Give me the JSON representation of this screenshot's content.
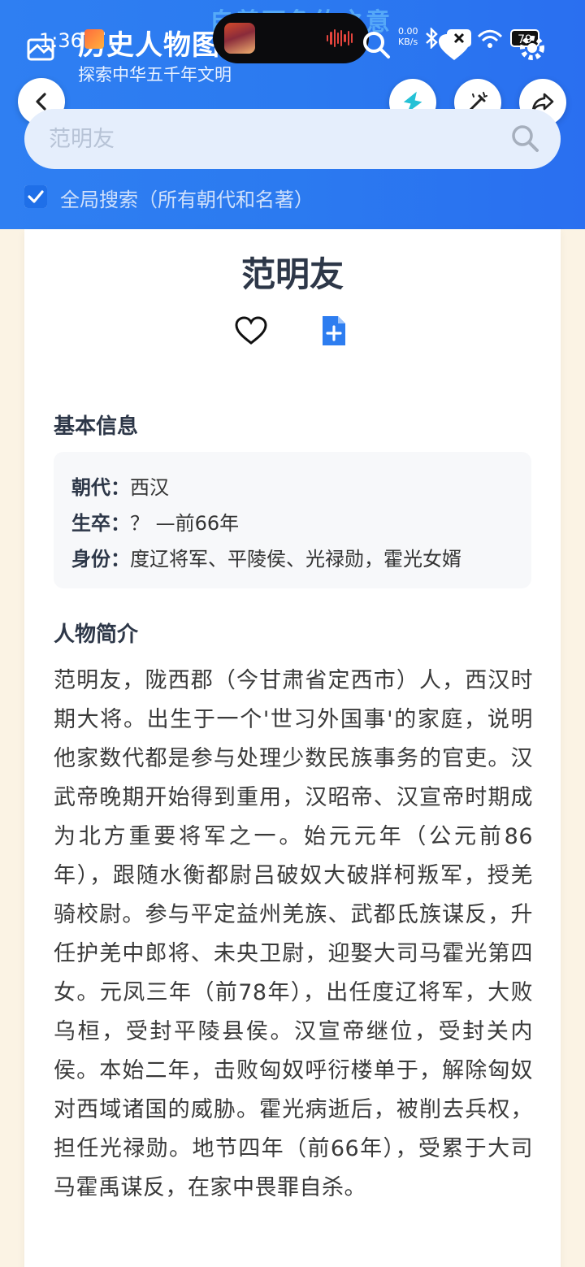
{
  "header": {
    "ghost_text": "自善不负约之意",
    "time": "1:36",
    "app_title": "历史人物图谱",
    "app_subtitle": "探索中华五千年文明",
    "net_speed_value": "0.00",
    "net_speed_unit": "KB/s",
    "battery": "79",
    "accent_color": "#2b7af0"
  },
  "actions": {
    "back": "back-icon",
    "bolt": "bolt-icon",
    "wand": "wand-icon",
    "share": "share-icon"
  },
  "search": {
    "value": "范明友",
    "placeholder": "范明友",
    "global_checked": true,
    "global_label": "全局搜索（所有朝代和名著）"
  },
  "person": {
    "name": "范明友",
    "basic_title": "基本信息",
    "basic": [
      {
        "key": "朝代：",
        "value": "西汉"
      },
      {
        "key": "生卒：",
        "value": "？ —前66年"
      },
      {
        "key": "身份：",
        "value": "度辽将军、平陵侯、光禄勋，霍光女婿"
      }
    ],
    "intro_title": "人物简介",
    "bio": "范明友，陇西郡（今甘肃省定西市）人，西汉时期大将。出生于一个'世习外国事'的家庭，说明他家数代都是参与处理少数民族事务的官吏。汉武帝晚期开始得到重用，汉昭帝、汉宣帝时期成为北方重要将军之一。始元元年（公元前86年），跟随水衡都尉吕破奴大破牂柯叛军，授羌骑校尉。参与平定益州羌族、武都氐族谋反，升任护羌中郎将、未央卫尉，迎娶大司马霍光第四女。元凤三年（前78年），出任度辽将军，大败乌桓，受封平陵县侯。汉宣帝继位，受封关内侯。本始二年，击败匈奴呼衍楼单于，解除匈奴对西域诸国的威胁。霍光病逝后，被削去兵权，担任光禄勋。地节四年（前66年），受累于大司马霍禹谋反，在家中畏罪自杀。"
  }
}
